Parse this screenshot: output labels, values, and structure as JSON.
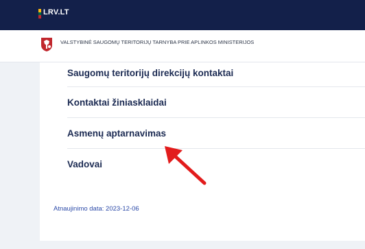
{
  "header": {
    "logo_text": "LRV.LT",
    "flag_colors": [
      "#fdb913",
      "#006a44",
      "#c1272d"
    ]
  },
  "org": {
    "name": "VALSTYBINĖ SAUGOMŲ TERITORIJŲ TARNYBA PRIE APLINKOS MINISTERIJOS",
    "emblem_icon": "coat-of-arms-icon"
  },
  "contacts_menu": {
    "items": [
      {
        "label": "Saugomų teritorijų direkcijų kontaktai"
      },
      {
        "label": "Kontaktai žiniasklaidai"
      },
      {
        "label": "Asmenų aptarnavimas"
      },
      {
        "label": "Vadovai"
      }
    ]
  },
  "footer": {
    "update_date": "Atnaujinimo data: 2023-12-06"
  },
  "annotation": {
    "icon": "red-arrow-icon",
    "color": "#e21c1c"
  }
}
